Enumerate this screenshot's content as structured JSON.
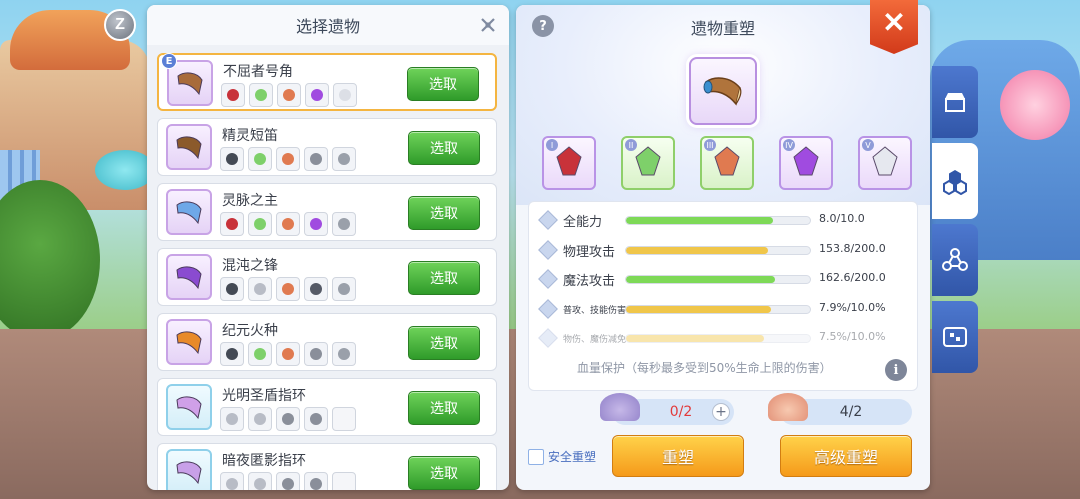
{
  "left_panel": {
    "title": "选择遗物",
    "select_label": "选取",
    "items": [
      {
        "name": "不屈者号角",
        "badge": "E",
        "selected": true,
        "icon_color": "#a86b3a",
        "frame": "purple",
        "minis": [
          "#c8323a",
          "#7ed06a",
          "#e07a50",
          "#a04be0",
          "#dcdfe6"
        ]
      },
      {
        "name": "精灵短笛",
        "badge": "",
        "selected": false,
        "icon_color": "#8b5a2b",
        "frame": "purple",
        "minis": [
          "#444a55",
          "#7ed06a",
          "#e07a50",
          "#8a8f9a",
          "#9aa0aa"
        ]
      },
      {
        "name": "灵脉之主",
        "badge": "",
        "selected": false,
        "icon_color": "#6ea8e8",
        "frame": "purple",
        "minis": [
          "#c8323a",
          "#7ed06a",
          "#e07a50",
          "#a04be0",
          "#9aa0aa"
        ]
      },
      {
        "name": "混沌之锋",
        "badge": "",
        "selected": false,
        "icon_color": "#8a4bd0",
        "frame": "purple",
        "minis": [
          "#444a55",
          "#b8bcc6",
          "#e07a50",
          "#555a66",
          "#9aa0aa"
        ]
      },
      {
        "name": "纪元火种",
        "badge": "",
        "selected": false,
        "icon_color": "#e88a2a",
        "frame": "purple",
        "minis": [
          "#444a55",
          "#7ed06a",
          "#e07a50",
          "#8a8f9a",
          "#9aa0aa"
        ]
      },
      {
        "name": "光明圣盾指环",
        "badge": "",
        "selected": false,
        "icon_color": "#d0a0e8",
        "frame": "blue",
        "minis": [
          "#b8bcc6",
          "#b8bcc6",
          "#8a8f9a",
          "#8a8f9a",
          ""
        ]
      },
      {
        "name": "暗夜匿影指环",
        "badge": "",
        "selected": false,
        "icon_color": "#c8a0e8",
        "frame": "blue",
        "minis": [
          "#b8bcc6",
          "#b8bcc6",
          "#8a8f9a",
          "#8a8f9a",
          ""
        ]
      }
    ]
  },
  "right_panel": {
    "title": "遗物重塑",
    "help": "?",
    "gems": [
      {
        "num": "I",
        "frame": "purple",
        "color": "#c8323a",
        "icon": "helmet-icon"
      },
      {
        "num": "II",
        "frame": "green",
        "color": "#7ed06a",
        "icon": "crystal-icon"
      },
      {
        "num": "III",
        "frame": "green",
        "color": "#e07a50",
        "icon": "gem-icon"
      },
      {
        "num": "IV",
        "frame": "purple",
        "color": "#a04be0",
        "icon": "scroll-icon"
      },
      {
        "num": "V",
        "frame": "purple",
        "color": "#e6e8ef",
        "icon": "wings-icon"
      }
    ],
    "stats": [
      {
        "name": "全能力",
        "value": "8.0/10.0",
        "fill": 0.8,
        "color": "#7ed957",
        "small": false,
        "faded": false
      },
      {
        "name": "物理攻击",
        "value": "153.8/200.0",
        "fill": 0.77,
        "color": "#f0c64a",
        "small": false,
        "faded": false
      },
      {
        "name": "魔法攻击",
        "value": "162.6/200.0",
        "fill": 0.81,
        "color": "#7ed957",
        "small": false,
        "faded": false
      },
      {
        "name": "普攻、技能伤害",
        "value": "7.9%/10.0%",
        "fill": 0.79,
        "color": "#f0c64a",
        "small": true,
        "faded": false
      },
      {
        "name": "物伤、魔伤减免",
        "value": "7.5%/10.0%",
        "fill": 0.75,
        "color": "#f0c64a",
        "small": true,
        "faded": true
      }
    ],
    "hp_note": "血量保护（每秒最多受到50%生命上限的伤害）",
    "info": "i",
    "materials": {
      "left_value": "0/2",
      "right_value": "4/2",
      "left_color": "#e23a3a",
      "right_color": "#3a3f4a"
    },
    "safe_label": "安全重塑",
    "reshape_label": "重塑",
    "advanced_label": "高级重塑"
  },
  "z_button": "Z",
  "close_glyph": "✕"
}
